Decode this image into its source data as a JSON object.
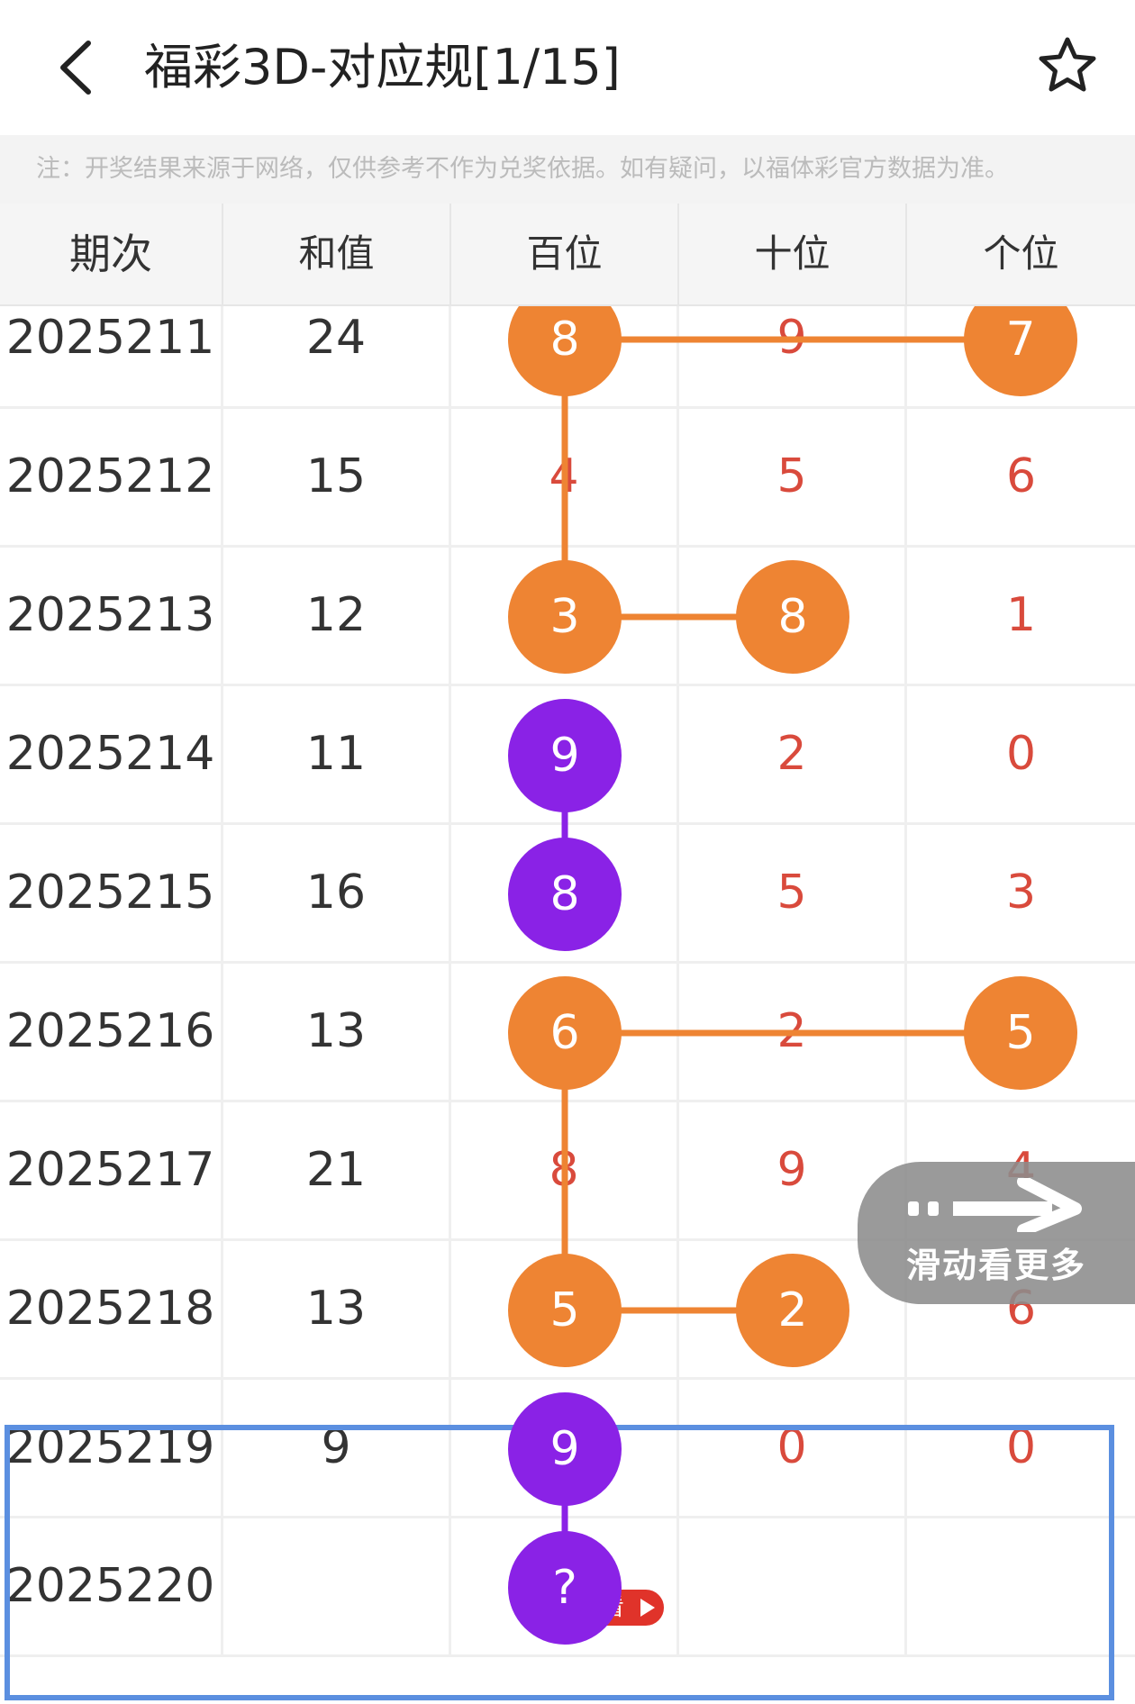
{
  "header": {
    "title": "福彩3D-对应规[1/15]",
    "back_icon": "chevron-left-icon",
    "favorite_icon": "star-outline-icon"
  },
  "notice": "注：开奖结果来源于网络，仅供参考不作为兑奖依据。如有疑问，以福体彩官方数据为准。",
  "table": {
    "columns": [
      "期次",
      "和值",
      "百位",
      "十位",
      "个位"
    ],
    "rows": [
      {
        "period": "2025211",
        "sum": "24",
        "d": [
          "8",
          "9",
          "7"
        ]
      },
      {
        "period": "2025212",
        "sum": "15",
        "d": [
          "4",
          "5",
          "6"
        ]
      },
      {
        "period": "2025213",
        "sum": "12",
        "d": [
          "3",
          "8",
          "1"
        ]
      },
      {
        "period": "2025214",
        "sum": "11",
        "d": [
          "9",
          "2",
          "0"
        ]
      },
      {
        "period": "2025215",
        "sum": "16",
        "d": [
          "8",
          "5",
          "3"
        ]
      },
      {
        "period": "2025216",
        "sum": "13",
        "d": [
          "6",
          "2",
          "5"
        ]
      },
      {
        "period": "2025217",
        "sum": "21",
        "d": [
          "8",
          "9",
          "4"
        ]
      },
      {
        "period": "2025218",
        "sum": "13",
        "d": [
          "5",
          "2",
          "6"
        ]
      },
      {
        "period": "2025219",
        "sum": "9",
        "d": [
          "9",
          "0",
          "0"
        ]
      },
      {
        "period": "2025220",
        "sum": "",
        "d": [
          "?",
          "",
          ""
        ]
      }
    ]
  },
  "swipe_hint": "滑动看更多",
  "view_badge": "查看",
  "colors": {
    "orange": "#ee8433",
    "purple": "#8a22e6",
    "digit_red": "#d94a3c",
    "highlight_blue": "#5b8fe0",
    "badge_red": "#e0332a"
  }
}
